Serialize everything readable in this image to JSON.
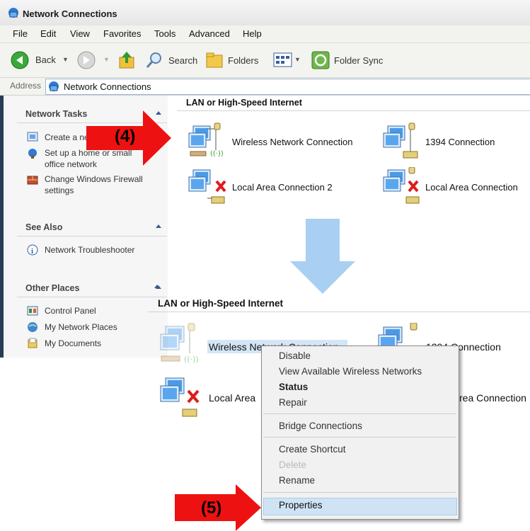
{
  "window": {
    "title": "Network Connections"
  },
  "menu": [
    "File",
    "Edit",
    "View",
    "Favorites",
    "Tools",
    "Advanced",
    "Help"
  ],
  "toolbar": {
    "back": "Back",
    "search": "Search",
    "folders": "Folders",
    "sync": "Folder Sync"
  },
  "address": {
    "label": "Address",
    "value": "Network Connections"
  },
  "tasks": {
    "network_tasks": {
      "title": "Network Tasks",
      "items": [
        "Create a new",
        "Set up a home or small",
        "office network",
        "Change Windows Firewall",
        "settings"
      ]
    },
    "see_also": {
      "title": "See Also",
      "items": [
        "Network Troubleshooter"
      ]
    },
    "other_places": {
      "title": "Other Places",
      "items": [
        "Control Panel",
        "My Network Places",
        "My Documents"
      ]
    }
  },
  "group_title": "LAN or High-Speed Internet",
  "connections": [
    "Wireless Network Connection",
    "1394 Connection",
    "Local Area Connection 2",
    "Local Area Connection"
  ],
  "lower_labels": {
    "wireless": "Wireless Network Connection",
    "c1394": "1394 Connection",
    "local_left": "Local Area",
    "local_right": "rea Connection"
  },
  "context_menu": {
    "items": [
      "Disable",
      "View Available Wireless Networks",
      "Status",
      "Repair",
      "Bridge Connections",
      "Create Shortcut",
      "Delete",
      "Rename",
      "Properties"
    ],
    "bold": "Status",
    "disabled": "Delete",
    "highlighted": "Properties"
  },
  "annotations": {
    "step4": "(4)",
    "step5": "(5)"
  },
  "colors": {
    "annotation_arrow": "#ee1111",
    "flow_arrow": "#a9cff3",
    "highlight": "#cfe3f5",
    "titlebar_text": "#1a1a1a"
  }
}
